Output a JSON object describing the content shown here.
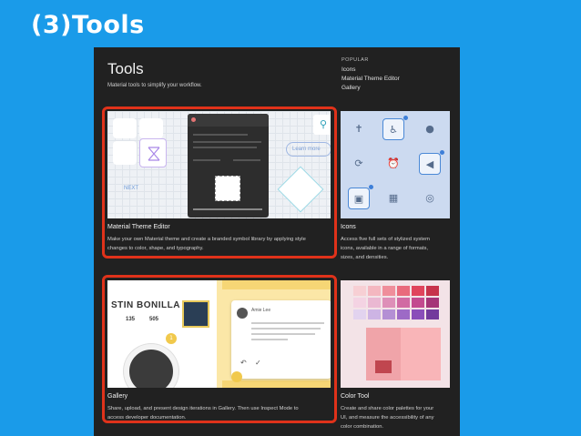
{
  "slide": {
    "title": "(3)Tools"
  },
  "header": {
    "title": "Tools",
    "subtitle": "Material tools to simplify your workflow."
  },
  "popular": {
    "heading": "POPULAR",
    "items": [
      "Icons",
      "Material Theme Editor",
      "Gallery"
    ]
  },
  "cards": {
    "theme_editor": {
      "title": "Material Theme Editor",
      "desc_line1": "Make your own Material theme and create a branded symbol library by applying style",
      "desc_line2": "changes to color, shape, and typography.",
      "next_label": "NEXT",
      "learn_label": "Learn more"
    },
    "icons": {
      "title": "Icons",
      "desc_line1": "Access five full sets of stylized system",
      "desc_line2": "icons, available in a range of formats,",
      "desc_line3": "sizes, and densities."
    },
    "gallery": {
      "title": "Gallery",
      "desc_line1": "Share, upload, and present design iterations in Gallery. Then use Inspect Mode to",
      "desc_line2": "access developer documentation.",
      "profile_name": "STIN BONILLA",
      "stat1": "135",
      "stat2": "505",
      "badge": "1",
      "comment_author": "Amie Lee"
    },
    "color_tool": {
      "title": "Color Tool",
      "desc_line1": "Create and share color palettes for your",
      "desc_line2": "UI, and measure the accessibility of any",
      "desc_line3": "color combination."
    }
  },
  "colors": {
    "slide_background": "#1a9be9",
    "panel_background": "#212121",
    "highlight": "#e0321a"
  }
}
